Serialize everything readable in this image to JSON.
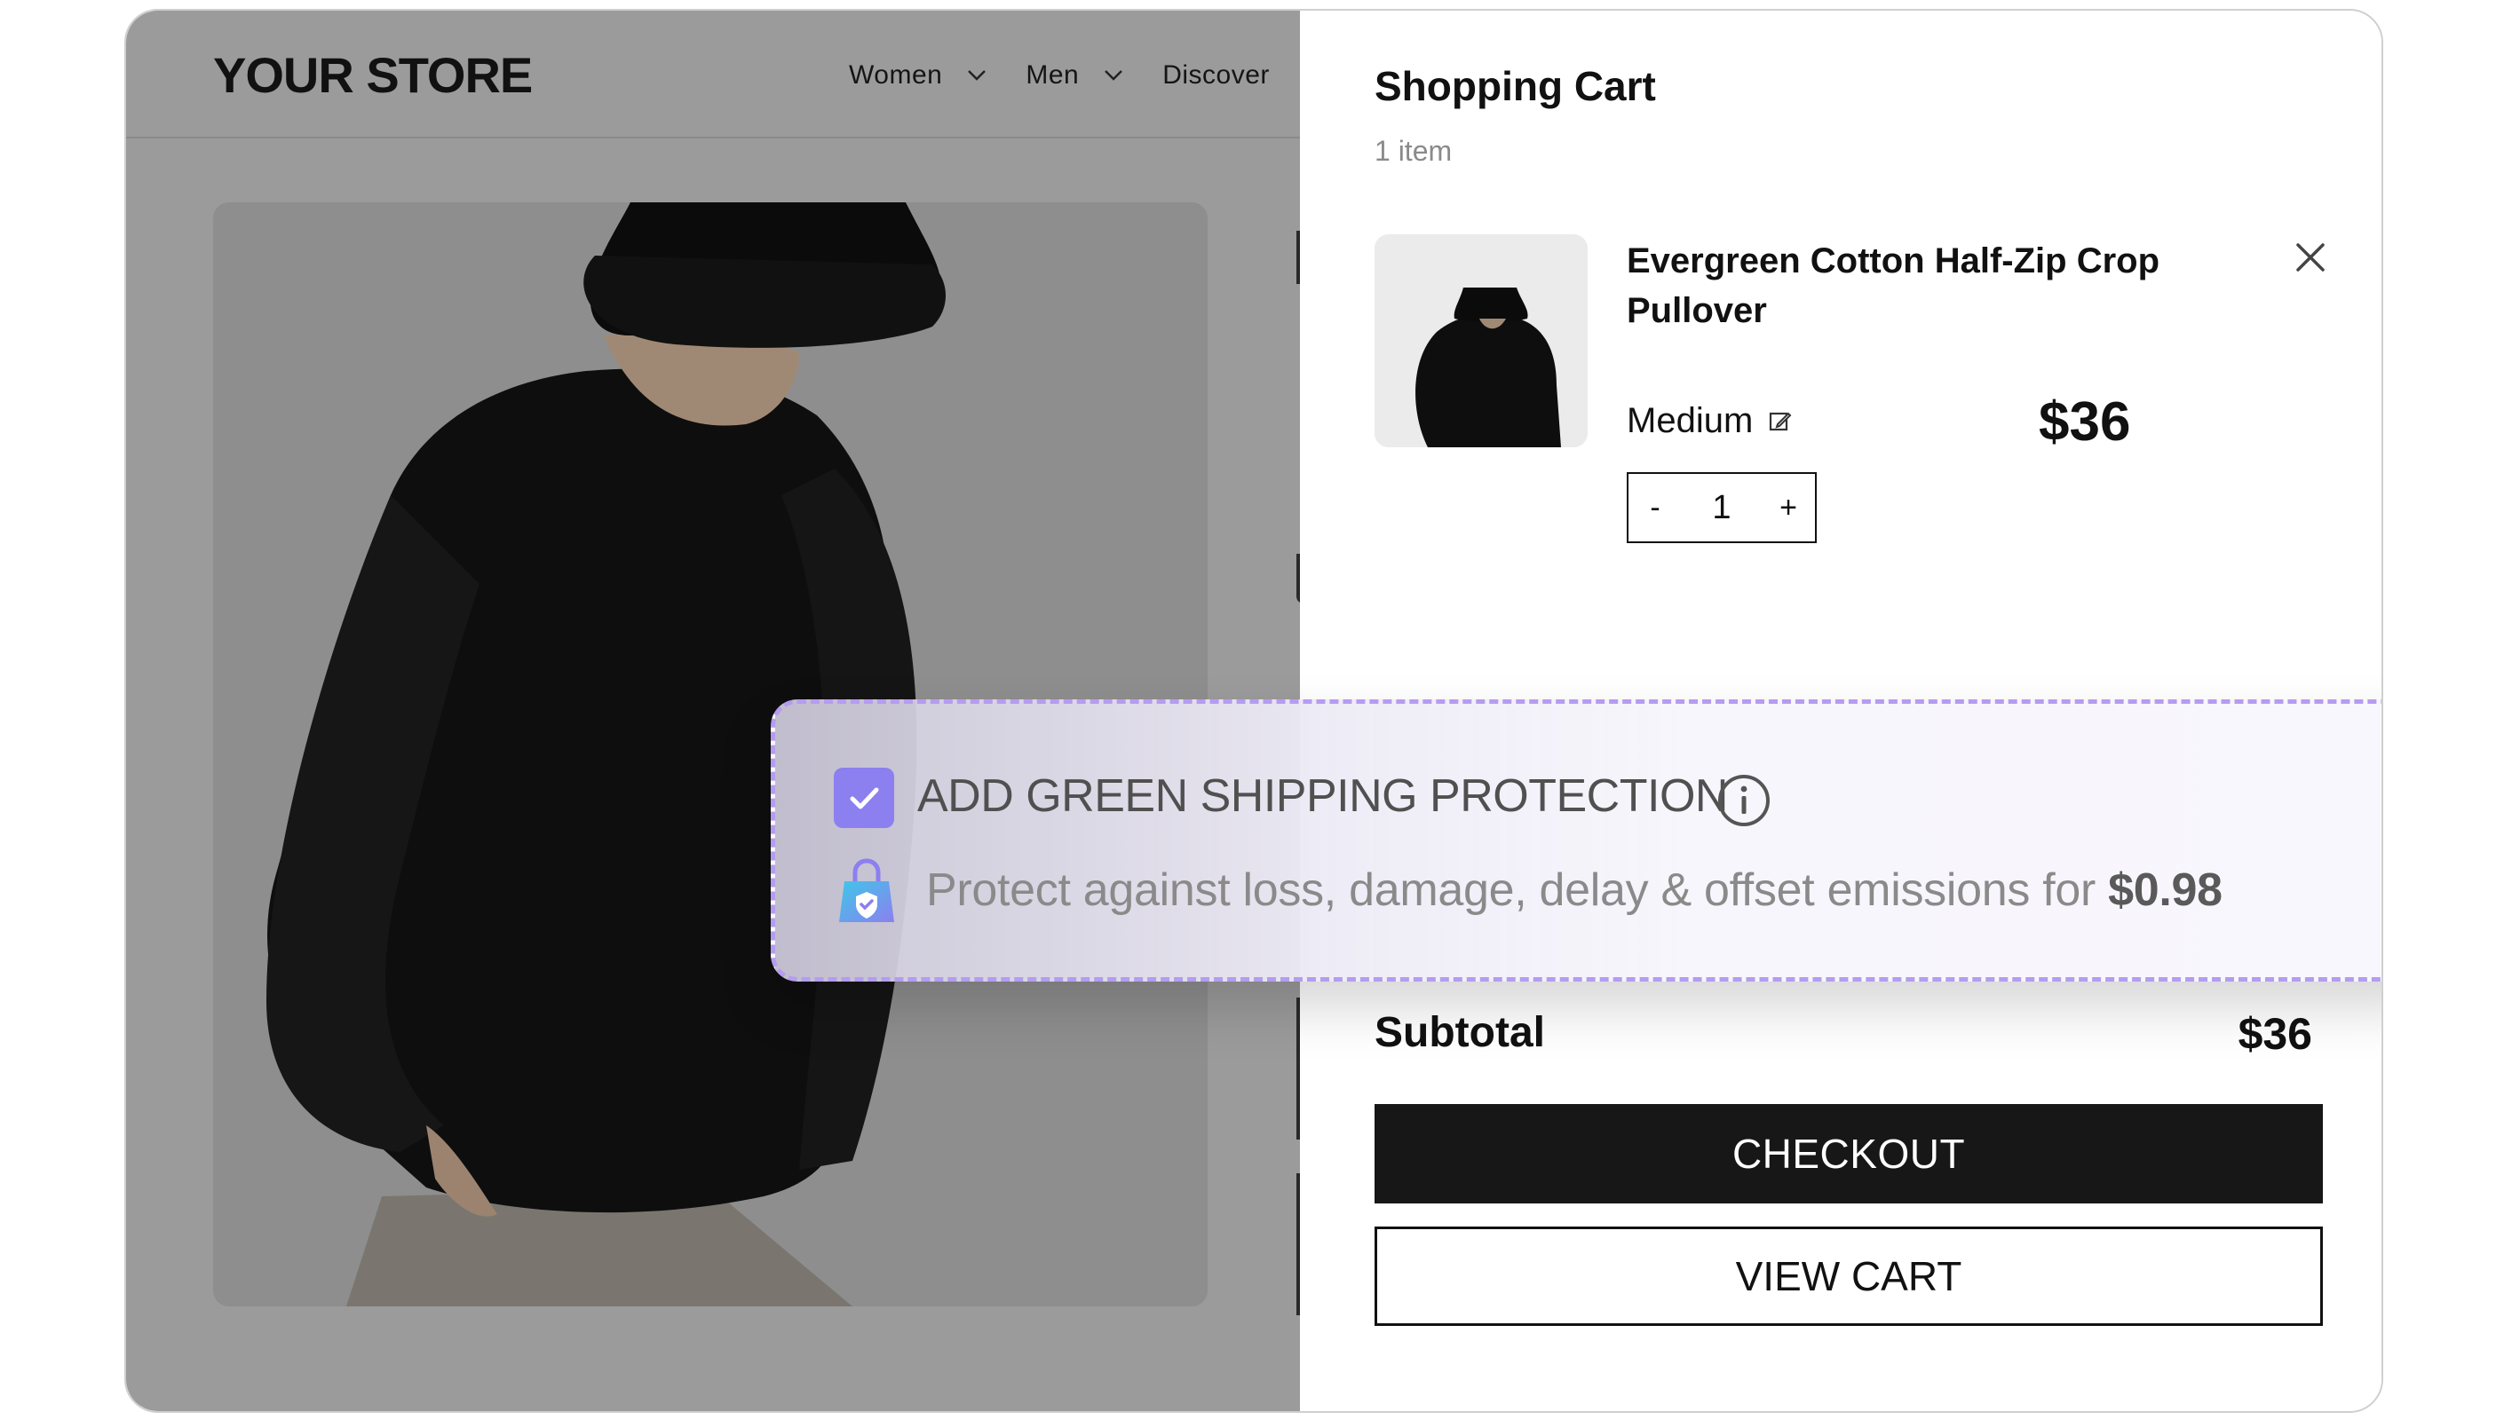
{
  "store": {
    "logo": "YOUR STORE",
    "nav": [
      {
        "label": "Women",
        "has_dropdown": true
      },
      {
        "label": "Men",
        "has_dropdown": true
      },
      {
        "label": "Discover",
        "has_dropdown": false
      }
    ],
    "hero_image": "model in black bucket hat and black oversized sweatshirt"
  },
  "cart": {
    "title": "Shopping Cart",
    "count_label": "1 item",
    "item": {
      "name": "Evergreen Cotton Half-Zip Crop Pullover",
      "variant": "Medium",
      "price": "$36",
      "quantity": "1",
      "qty_minus": "-",
      "qty_plus": "+",
      "image": "black pullover with bucket hat"
    },
    "subtotal_label": "Subtotal",
    "subtotal_value": "$36",
    "checkout_label": "CHECKOUT",
    "view_cart_label": "VIEW CART"
  },
  "protection": {
    "checked": true,
    "title": "ADD GREEN SHIPPING PROTECTION",
    "description": "Protect against loss, damage, delay & offset emissions for",
    "price": "$0.98"
  },
  "colors": {
    "accent": "#8c7ff0",
    "dash_border": "#b59cf0",
    "overlay": "#9b9b9b",
    "button_dark": "#171717"
  },
  "icons": [
    "chevron-down-icon",
    "close-icon",
    "edit-icon",
    "checkmark-icon",
    "info-icon",
    "shield-lock-bag-icon"
  ]
}
